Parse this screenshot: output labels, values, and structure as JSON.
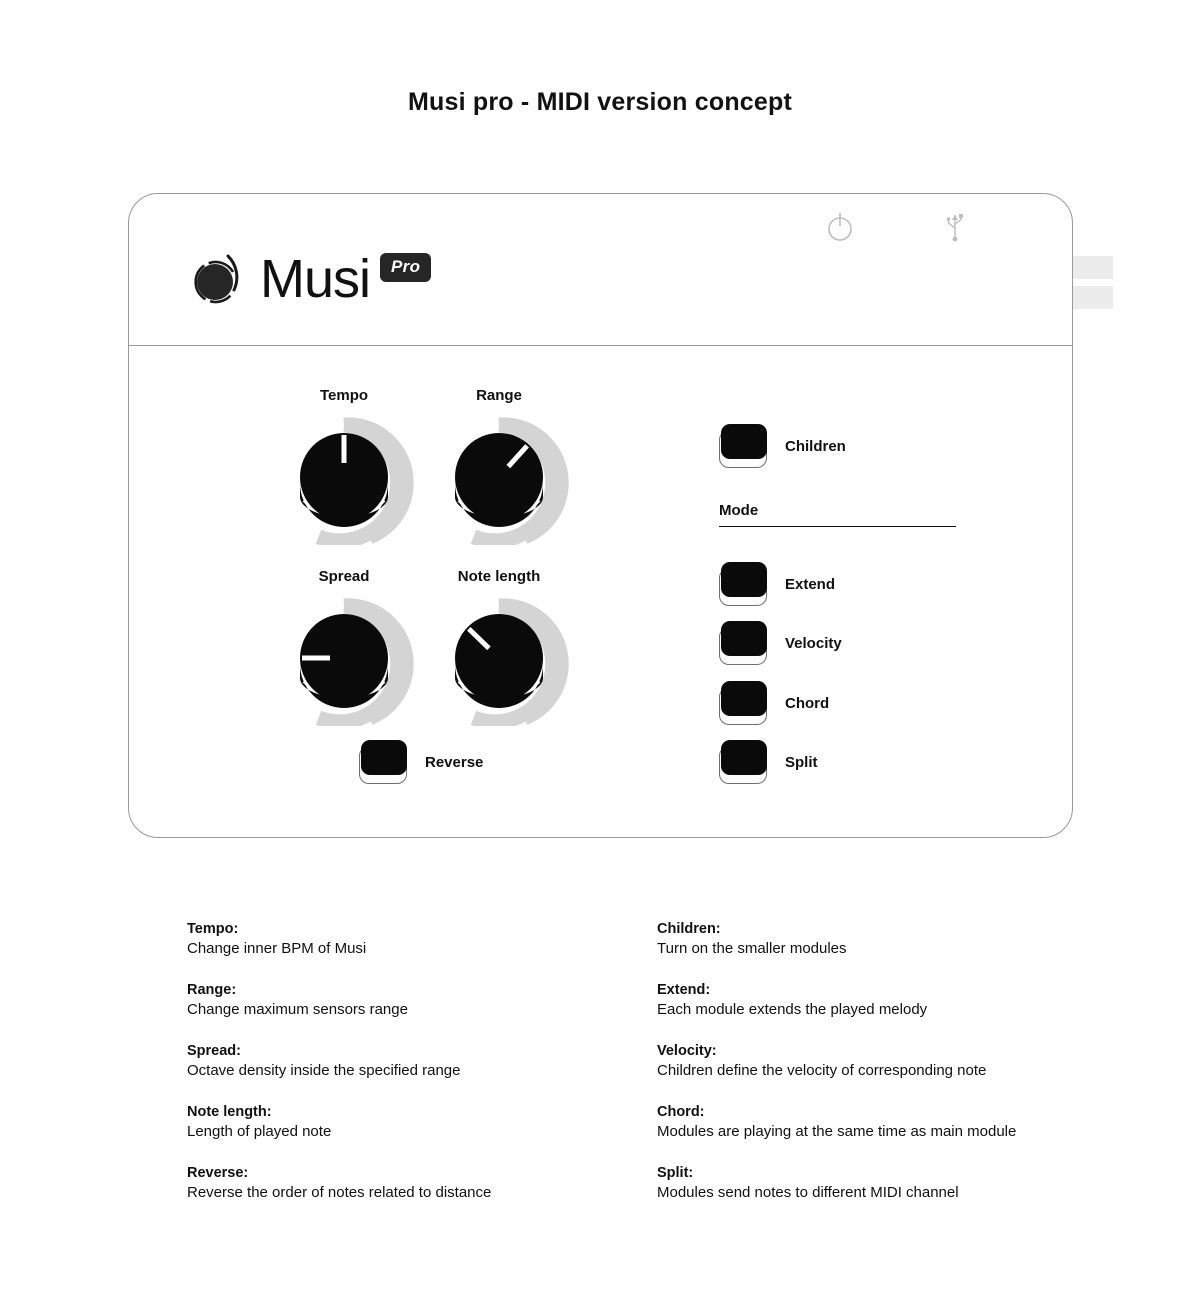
{
  "page": {
    "title": "Musi pro - MIDI version concept"
  },
  "device": {
    "logo": {
      "mark_icon": "musi-orbit-icon",
      "wordmark": "Musi",
      "badge": "Pro"
    },
    "header_icons": [
      {
        "name": "power-icon",
        "label": "power"
      },
      {
        "name": "usb-icon",
        "label": "usb"
      }
    ],
    "connectors": [
      {
        "name": "connector-tab-top"
      },
      {
        "name": "connector-tab-bottom"
      }
    ],
    "knobs": [
      {
        "id": "tempo",
        "label": "Tempo",
        "angle": 0,
        "value_deg": 0
      },
      {
        "id": "range",
        "label": "Range",
        "angle": 42,
        "value_deg": 42
      },
      {
        "id": "spread",
        "label": "Spread",
        "angle": -90,
        "value_deg": -90
      },
      {
        "id": "note-length",
        "label": "Note length",
        "angle": -46,
        "value_deg": -46
      }
    ],
    "buttons": [
      {
        "id": "children",
        "label": "Children"
      },
      {
        "id": "reverse",
        "label": "Reverse"
      }
    ],
    "mode": {
      "title": "Mode",
      "buttons": [
        {
          "id": "extend",
          "label": "Extend"
        },
        {
          "id": "velocity",
          "label": "Velocity"
        },
        {
          "id": "chord",
          "label": "Chord"
        },
        {
          "id": "split",
          "label": "Split"
        }
      ]
    }
  },
  "legend": {
    "left": [
      {
        "term": "Tempo:",
        "definition": "Change inner BPM of Musi"
      },
      {
        "term": "Range:",
        "definition": "Change maximum sensors range"
      },
      {
        "term": "Spread:",
        "definition": "Octave density inside the specified range"
      },
      {
        "term": "Note length:",
        "definition": "Length of played note"
      },
      {
        "term": "Reverse:",
        "definition": "Reverse the order of notes related to distance"
      }
    ],
    "right": [
      {
        "term": "Children:",
        "definition": "Turn on the smaller modules"
      },
      {
        "term": "Extend:",
        "definition": "Each module extends the played melody"
      },
      {
        "term": "Velocity:",
        "definition": "Children define the velocity of corresponding note"
      },
      {
        "term": "Chord:",
        "definition": "Modules are playing at the same time as main module"
      },
      {
        "term": "Split:",
        "definition": "Modules send notes to different MIDI channel"
      }
    ]
  },
  "colors": {
    "ink": "#111111",
    "panel_border": "#9a9a9a",
    "knob_ring": "#d4d4d4",
    "knob_cap": "#0a0a0a",
    "icon_gray": "#b9b9b9",
    "connector": "#ececec"
  }
}
